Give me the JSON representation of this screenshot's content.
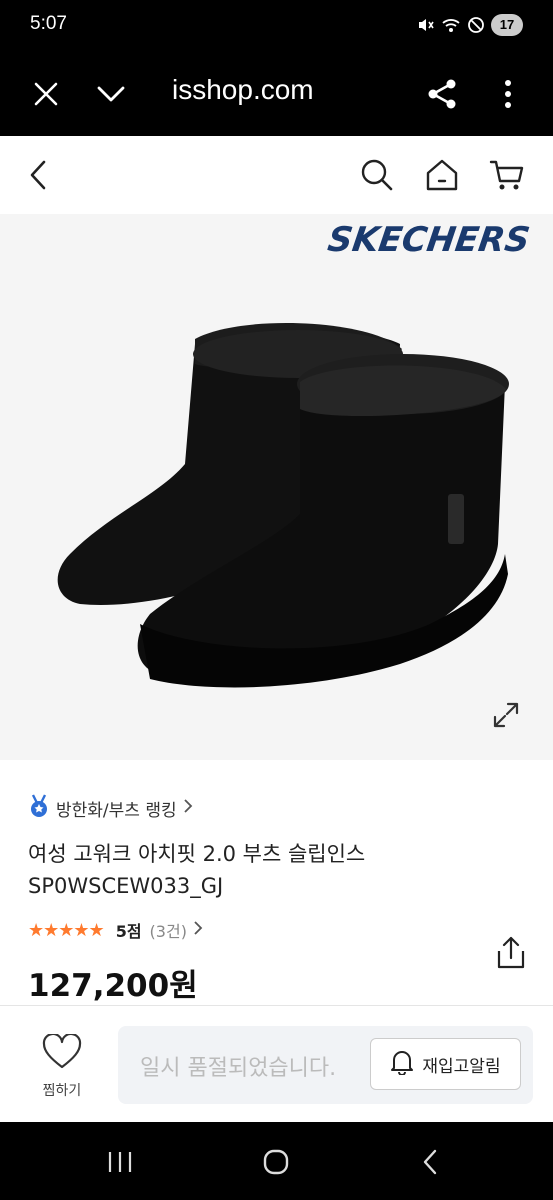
{
  "status_bar": {
    "time": "5:07",
    "battery": "17"
  },
  "browser": {
    "url": "isshop.com",
    "icons": [
      "close-icon",
      "chevron-down-icon",
      "share-icon",
      "more-vertical-icon"
    ]
  },
  "header": {
    "icons": [
      "back-icon",
      "search-icon",
      "home-icon",
      "cart-icon"
    ]
  },
  "product": {
    "brand": "SKECHERS",
    "ranking_label": "방한화/부츠 랭킹",
    "title": "여성 고워크 아치핏 2.0 부츠 슬립인스 SP0WSCEW033_GJ",
    "stars": "★★★★★",
    "score": "5점",
    "review_count": "(3건)",
    "price": "127,200원",
    "star_color": "#ff7a2e"
  },
  "bottom_bar": {
    "wish_label": "찜하기",
    "soldout_text": "일시 품절되었습니다.",
    "restock_label": "재입고알림"
  },
  "nav": {
    "icons": [
      "recent-apps-icon",
      "home-circle-icon",
      "nav-back-icon"
    ]
  }
}
